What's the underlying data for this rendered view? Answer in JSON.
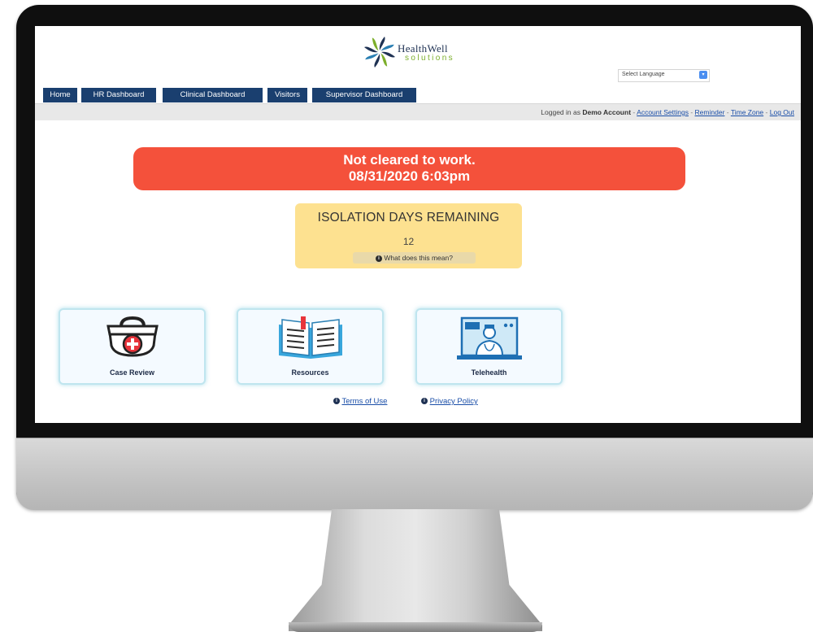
{
  "brand": {
    "name": "HealthWell",
    "sub": "solutions"
  },
  "language": {
    "label": "Select Language"
  },
  "nav": [
    "Home",
    "HR Dashboard",
    "Clinical Dashboard",
    "Visitors",
    "Supervisor Dashboard"
  ],
  "userbar": {
    "prefix": "Logged in as",
    "user": "Demo Account",
    "links": [
      "Account Settings",
      "Reminder",
      "Time Zone",
      "Log Out"
    ]
  },
  "alert": {
    "line1": "Not cleared to work.",
    "line2": "08/31/2020 6:03pm",
    "color": "#f4513b"
  },
  "isolation": {
    "title": "ISOLATION DAYS REMAINING",
    "count": "12",
    "help": "What does this mean?"
  },
  "cards": [
    {
      "label": "Case Review",
      "icon": "medical-kit-icon"
    },
    {
      "label": "Resources",
      "icon": "open-book-icon"
    },
    {
      "label": "Telehealth",
      "icon": "telehealth-monitor-icon"
    }
  ],
  "footer": {
    "terms": "Terms of Use",
    "privacy": "Privacy Policy"
  },
  "colors": {
    "nav": "#1a3f6f",
    "accent": "#f4513b",
    "isolation": "#fde190"
  }
}
